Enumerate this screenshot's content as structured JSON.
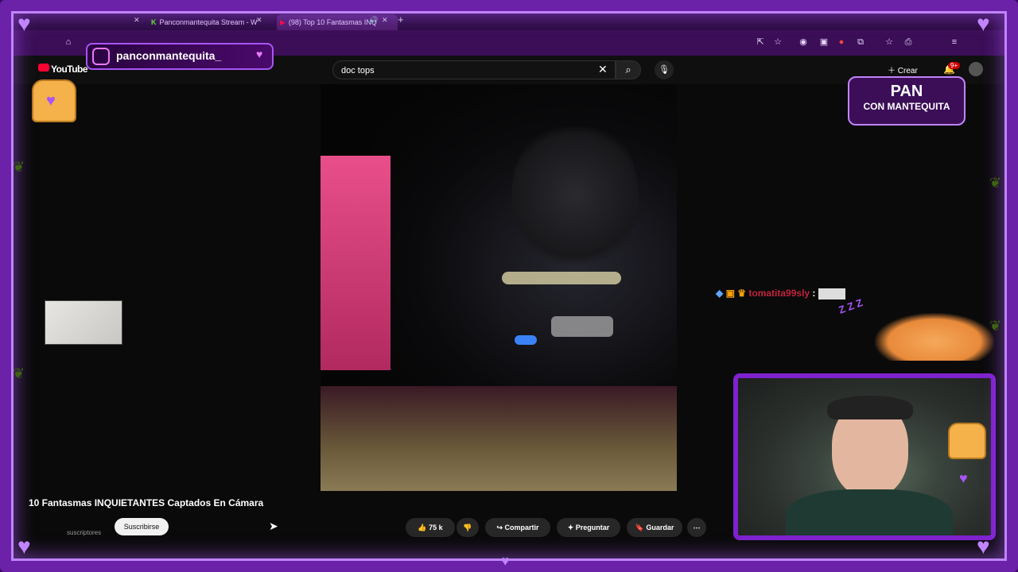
{
  "browser": {
    "tabs": [
      {
        "label": "Panconmantequita Stream - W",
        "favicon": "kick-icon",
        "color": "#53fc18"
      },
      {
        "label": "(98) Top 10 Fantasmas INQ",
        "favicon": "youtube-icon",
        "color": "#ff0033"
      }
    ]
  },
  "youtube": {
    "logo": "YouTube",
    "search_value": "doc tops",
    "create_label": "Crear",
    "notification_badge": "9+",
    "video_title": "10 Fantasmas INQUIETANTES Captados En Cámara",
    "subscribers_label": "suscriptores",
    "subscribe_label": "Suscribirse",
    "like_count": "75 k",
    "share_label": "Compartir",
    "ask_label": "Preguntar",
    "save_label": "Guardar"
  },
  "overlay": {
    "instagram_handle": "panconmantequita_",
    "logo_line1": "PAN",
    "logo_line2": "CON MANTEQUITA",
    "chat_user": "tomatita99sly",
    "chat_separator": ":",
    "snore": "Z Z Z"
  },
  "colors": {
    "frame": "#6b21a8",
    "accent": "#c084fc",
    "chat_name": "#c0233d"
  }
}
